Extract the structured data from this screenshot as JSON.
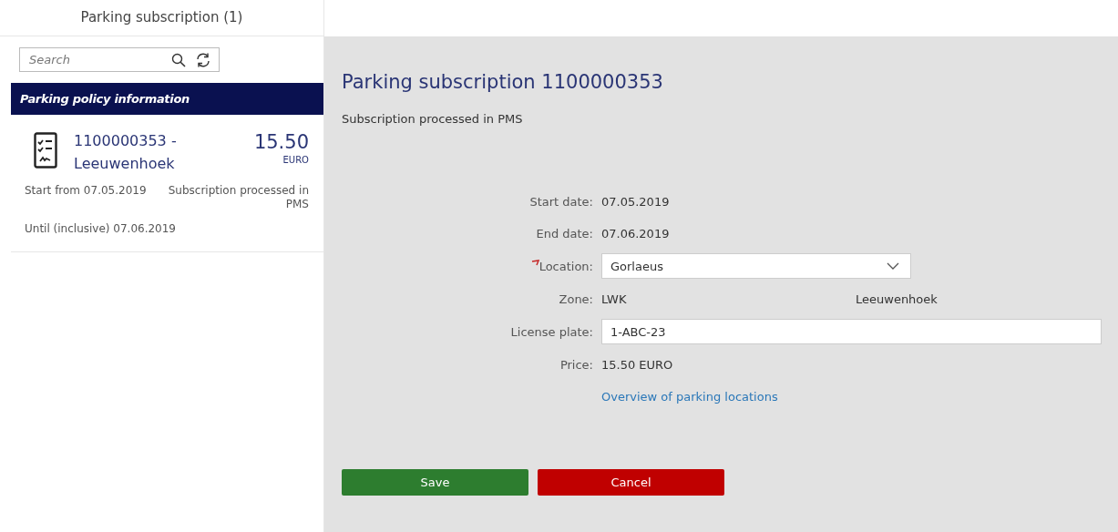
{
  "master": {
    "title": "Parking subscription (1)",
    "search": {
      "placeholder": "Search"
    },
    "group_header": "Parking policy information",
    "items": [
      {
        "title": "1100000353 - Leeuwenhoek",
        "amount": "15.50",
        "currency": "EURO",
        "start": "Start from 07.05.2019",
        "status": "Subscription processed in PMS",
        "until": "Until (inclusive) 07.06.2019",
        "selected": false
      }
    ]
  },
  "detail": {
    "title": "Parking subscription 1100000353",
    "status": "Subscription processed in PMS",
    "fields": [
      {
        "kind": "text",
        "label": "Start date:",
        "value": "07.05.2019",
        "required": false
      },
      {
        "kind": "text",
        "label": "End date:",
        "value": "07.06.2019",
        "required": false
      },
      {
        "kind": "select",
        "label": "Location:",
        "value": "Gorlaeus",
        "required": true
      },
      {
        "kind": "pair",
        "label": "Zone:",
        "value": "LWK",
        "extra": "Leeuwenhoek",
        "required": false
      },
      {
        "kind": "input",
        "label": "License plate:",
        "value": "1-ABC-23",
        "required": false
      },
      {
        "kind": "text",
        "label": "Price:",
        "value": "15.50 EURO",
        "required": false
      },
      {
        "kind": "link",
        "value": "Overview of parking locations",
        "required": false
      }
    ],
    "buttons": [
      {
        "kind": "accept",
        "label": "Save"
      },
      {
        "kind": "reject",
        "label": "Cancel"
      }
    ]
  }
}
